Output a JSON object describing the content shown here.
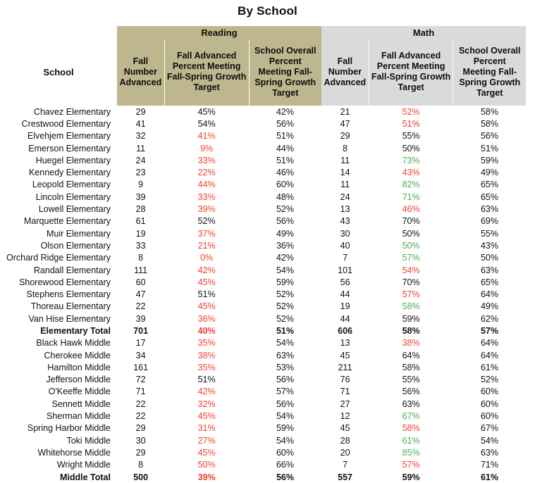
{
  "title": "By School",
  "colors": {
    "reading_header_bg": "#BDB68F",
    "math_header_bg": "#DADADA",
    "below_target": "#F0402F",
    "above_target": "#4CB050",
    "neutral": "#111111"
  },
  "header": {
    "school_label": "School",
    "groups": [
      {
        "label": "Reading",
        "span": 3,
        "theme": "reading"
      },
      {
        "label": "Math",
        "span": 3,
        "theme": "math"
      }
    ],
    "subheaders": [
      "Fall Number Advanced",
      "Fall Advanced Percent Meeting Fall-Spring Growth Target",
      "School Overall Percent Meeting Fall-Spring Growth Target",
      "Fall Number Advanced",
      "Fall Advanced Percent Meeting Fall-Spring Growth Target",
      "School Overall Percent Meeting Fall-Spring Growth Target"
    ]
  },
  "rows": [
    {
      "school": "Chavez Elementary",
      "total": false,
      "cells": [
        {
          "v": "29",
          "c": "plain"
        },
        {
          "v": "45%",
          "c": "plain"
        },
        {
          "v": "42%",
          "c": "plain"
        },
        {
          "v": "21",
          "c": "plain"
        },
        {
          "v": "52%",
          "c": "red"
        },
        {
          "v": "58%",
          "c": "plain"
        }
      ]
    },
    {
      "school": "Crestwood Elementary",
      "total": false,
      "cells": [
        {
          "v": "41",
          "c": "plain"
        },
        {
          "v": "54%",
          "c": "plain"
        },
        {
          "v": "56%",
          "c": "plain"
        },
        {
          "v": "47",
          "c": "plain"
        },
        {
          "v": "51%",
          "c": "red"
        },
        {
          "v": "58%",
          "c": "plain"
        }
      ]
    },
    {
      "school": "Elvehjem Elementary",
      "total": false,
      "cells": [
        {
          "v": "32",
          "c": "plain"
        },
        {
          "v": "41%",
          "c": "red"
        },
        {
          "v": "51%",
          "c": "plain"
        },
        {
          "v": "29",
          "c": "plain"
        },
        {
          "v": "55%",
          "c": "plain"
        },
        {
          "v": "56%",
          "c": "plain"
        }
      ]
    },
    {
      "school": "Emerson Elementary",
      "total": false,
      "cells": [
        {
          "v": "11",
          "c": "plain"
        },
        {
          "v": "9%",
          "c": "red"
        },
        {
          "v": "44%",
          "c": "plain"
        },
        {
          "v": "8",
          "c": "plain"
        },
        {
          "v": "50%",
          "c": "plain"
        },
        {
          "v": "51%",
          "c": "plain"
        }
      ]
    },
    {
      "school": "Huegel Elementary",
      "total": false,
      "cells": [
        {
          "v": "24",
          "c": "plain"
        },
        {
          "v": "33%",
          "c": "red"
        },
        {
          "v": "51%",
          "c": "plain"
        },
        {
          "v": "11",
          "c": "plain"
        },
        {
          "v": "73%",
          "c": "green"
        },
        {
          "v": "59%",
          "c": "plain"
        }
      ]
    },
    {
      "school": "Kennedy Elementary",
      "total": false,
      "cells": [
        {
          "v": "23",
          "c": "plain"
        },
        {
          "v": "22%",
          "c": "red"
        },
        {
          "v": "46%",
          "c": "plain"
        },
        {
          "v": "14",
          "c": "plain"
        },
        {
          "v": "43%",
          "c": "red"
        },
        {
          "v": "49%",
          "c": "plain"
        }
      ]
    },
    {
      "school": "Leopold Elementary",
      "total": false,
      "cells": [
        {
          "v": "9",
          "c": "plain"
        },
        {
          "v": "44%",
          "c": "red"
        },
        {
          "v": "60%",
          "c": "plain"
        },
        {
          "v": "11",
          "c": "plain"
        },
        {
          "v": "82%",
          "c": "green"
        },
        {
          "v": "65%",
          "c": "plain"
        }
      ]
    },
    {
      "school": "Lincoln Elementary",
      "total": false,
      "cells": [
        {
          "v": "39",
          "c": "plain"
        },
        {
          "v": "33%",
          "c": "red"
        },
        {
          "v": "48%",
          "c": "plain"
        },
        {
          "v": "24",
          "c": "plain"
        },
        {
          "v": "71%",
          "c": "green"
        },
        {
          "v": "65%",
          "c": "plain"
        }
      ]
    },
    {
      "school": "Lowell Elementary",
      "total": false,
      "cells": [
        {
          "v": "28",
          "c": "plain"
        },
        {
          "v": "39%",
          "c": "red"
        },
        {
          "v": "52%",
          "c": "plain"
        },
        {
          "v": "13",
          "c": "plain"
        },
        {
          "v": "46%",
          "c": "red"
        },
        {
          "v": "63%",
          "c": "plain"
        }
      ]
    },
    {
      "school": "Marquette Elementary",
      "total": false,
      "cells": [
        {
          "v": "61",
          "c": "plain"
        },
        {
          "v": "52%",
          "c": "plain"
        },
        {
          "v": "56%",
          "c": "plain"
        },
        {
          "v": "43",
          "c": "plain"
        },
        {
          "v": "70%",
          "c": "plain"
        },
        {
          "v": "69%",
          "c": "plain"
        }
      ]
    },
    {
      "school": "Muir Elementary",
      "total": false,
      "cells": [
        {
          "v": "19",
          "c": "plain"
        },
        {
          "v": "37%",
          "c": "red"
        },
        {
          "v": "49%",
          "c": "plain"
        },
        {
          "v": "30",
          "c": "plain"
        },
        {
          "v": "50%",
          "c": "plain"
        },
        {
          "v": "55%",
          "c": "plain"
        }
      ]
    },
    {
      "school": "Olson Elementary",
      "total": false,
      "cells": [
        {
          "v": "33",
          "c": "plain"
        },
        {
          "v": "21%",
          "c": "red"
        },
        {
          "v": "36%",
          "c": "plain"
        },
        {
          "v": "40",
          "c": "plain"
        },
        {
          "v": "50%",
          "c": "green"
        },
        {
          "v": "43%",
          "c": "plain"
        }
      ]
    },
    {
      "school": "Orchard Ridge Elementary",
      "total": false,
      "cells": [
        {
          "v": "8",
          "c": "plain"
        },
        {
          "v": "0%",
          "c": "red"
        },
        {
          "v": "42%",
          "c": "plain"
        },
        {
          "v": "7",
          "c": "plain"
        },
        {
          "v": "57%",
          "c": "green"
        },
        {
          "v": "50%",
          "c": "plain"
        }
      ]
    },
    {
      "school": "Randall Elementary",
      "total": false,
      "cells": [
        {
          "v": "111",
          "c": "plain"
        },
        {
          "v": "42%",
          "c": "red"
        },
        {
          "v": "54%",
          "c": "plain"
        },
        {
          "v": "101",
          "c": "plain"
        },
        {
          "v": "54%",
          "c": "red"
        },
        {
          "v": "63%",
          "c": "plain"
        }
      ]
    },
    {
      "school": "Shorewood Elementary",
      "total": false,
      "cells": [
        {
          "v": "60",
          "c": "plain"
        },
        {
          "v": "45%",
          "c": "red"
        },
        {
          "v": "59%",
          "c": "plain"
        },
        {
          "v": "56",
          "c": "plain"
        },
        {
          "v": "70%",
          "c": "plain"
        },
        {
          "v": "65%",
          "c": "plain"
        }
      ]
    },
    {
      "school": "Stephens Elementary",
      "total": false,
      "cells": [
        {
          "v": "47",
          "c": "plain"
        },
        {
          "v": "51%",
          "c": "plain"
        },
        {
          "v": "52%",
          "c": "plain"
        },
        {
          "v": "44",
          "c": "plain"
        },
        {
          "v": "57%",
          "c": "red"
        },
        {
          "v": "64%",
          "c": "plain"
        }
      ]
    },
    {
      "school": "Thoreau Elementary",
      "total": false,
      "cells": [
        {
          "v": "22",
          "c": "plain"
        },
        {
          "v": "45%",
          "c": "red"
        },
        {
          "v": "52%",
          "c": "plain"
        },
        {
          "v": "19",
          "c": "plain"
        },
        {
          "v": "58%",
          "c": "green"
        },
        {
          "v": "49%",
          "c": "plain"
        }
      ]
    },
    {
      "school": "Van Hise Elementary",
      "total": false,
      "cells": [
        {
          "v": "39",
          "c": "plain"
        },
        {
          "v": "36%",
          "c": "red"
        },
        {
          "v": "52%",
          "c": "plain"
        },
        {
          "v": "44",
          "c": "plain"
        },
        {
          "v": "59%",
          "c": "plain"
        },
        {
          "v": "62%",
          "c": "plain"
        }
      ]
    },
    {
      "school": "Elementary Total",
      "total": true,
      "cells": [
        {
          "v": "701",
          "c": "plain"
        },
        {
          "v": "40%",
          "c": "red"
        },
        {
          "v": "51%",
          "c": "plain"
        },
        {
          "v": "606",
          "c": "plain"
        },
        {
          "v": "58%",
          "c": "plain"
        },
        {
          "v": "57%",
          "c": "plain"
        }
      ]
    },
    {
      "school": "Black Hawk Middle",
      "total": false,
      "cells": [
        {
          "v": "17",
          "c": "plain"
        },
        {
          "v": "35%",
          "c": "red"
        },
        {
          "v": "54%",
          "c": "plain"
        },
        {
          "v": "13",
          "c": "plain"
        },
        {
          "v": "38%",
          "c": "red"
        },
        {
          "v": "64%",
          "c": "plain"
        }
      ]
    },
    {
      "school": "Cherokee Middle",
      "total": false,
      "cells": [
        {
          "v": "34",
          "c": "plain"
        },
        {
          "v": "38%",
          "c": "red"
        },
        {
          "v": "63%",
          "c": "plain"
        },
        {
          "v": "45",
          "c": "plain"
        },
        {
          "v": "64%",
          "c": "plain"
        },
        {
          "v": "64%",
          "c": "plain"
        }
      ]
    },
    {
      "school": "Hamilton Middle",
      "total": false,
      "cells": [
        {
          "v": "161",
          "c": "plain"
        },
        {
          "v": "35%",
          "c": "red"
        },
        {
          "v": "53%",
          "c": "plain"
        },
        {
          "v": "211",
          "c": "plain"
        },
        {
          "v": "58%",
          "c": "plain"
        },
        {
          "v": "61%",
          "c": "plain"
        }
      ]
    },
    {
      "school": "Jefferson Middle",
      "total": false,
      "cells": [
        {
          "v": "72",
          "c": "plain"
        },
        {
          "v": "51%",
          "c": "plain"
        },
        {
          "v": "56%",
          "c": "plain"
        },
        {
          "v": "76",
          "c": "plain"
        },
        {
          "v": "55%",
          "c": "plain"
        },
        {
          "v": "52%",
          "c": "plain"
        }
      ]
    },
    {
      "school": "O'Keeffe Middle",
      "total": false,
      "cells": [
        {
          "v": "71",
          "c": "plain"
        },
        {
          "v": "42%",
          "c": "red"
        },
        {
          "v": "57%",
          "c": "plain"
        },
        {
          "v": "71",
          "c": "plain"
        },
        {
          "v": "56%",
          "c": "plain"
        },
        {
          "v": "60%",
          "c": "plain"
        }
      ]
    },
    {
      "school": "Sennett Middle",
      "total": false,
      "cells": [
        {
          "v": "22",
          "c": "plain"
        },
        {
          "v": "32%",
          "c": "red"
        },
        {
          "v": "56%",
          "c": "plain"
        },
        {
          "v": "27",
          "c": "plain"
        },
        {
          "v": "63%",
          "c": "plain"
        },
        {
          "v": "60%",
          "c": "plain"
        }
      ]
    },
    {
      "school": "Sherman Middle",
      "total": false,
      "cells": [
        {
          "v": "22",
          "c": "plain"
        },
        {
          "v": "45%",
          "c": "red"
        },
        {
          "v": "54%",
          "c": "plain"
        },
        {
          "v": "12",
          "c": "plain"
        },
        {
          "v": "67%",
          "c": "green"
        },
        {
          "v": "60%",
          "c": "plain"
        }
      ]
    },
    {
      "school": "Spring Harbor Middle",
      "total": false,
      "cells": [
        {
          "v": "29",
          "c": "plain"
        },
        {
          "v": "31%",
          "c": "red"
        },
        {
          "v": "59%",
          "c": "plain"
        },
        {
          "v": "45",
          "c": "plain"
        },
        {
          "v": "58%",
          "c": "red"
        },
        {
          "v": "67%",
          "c": "plain"
        }
      ]
    },
    {
      "school": "Toki Middle",
      "total": false,
      "cells": [
        {
          "v": "30",
          "c": "plain"
        },
        {
          "v": "27%",
          "c": "red"
        },
        {
          "v": "54%",
          "c": "plain"
        },
        {
          "v": "28",
          "c": "plain"
        },
        {
          "v": "61%",
          "c": "green"
        },
        {
          "v": "54%",
          "c": "plain"
        }
      ]
    },
    {
      "school": "Whitehorse Middle",
      "total": false,
      "cells": [
        {
          "v": "29",
          "c": "plain"
        },
        {
          "v": "45%",
          "c": "red"
        },
        {
          "v": "60%",
          "c": "plain"
        },
        {
          "v": "20",
          "c": "plain"
        },
        {
          "v": "85%",
          "c": "green"
        },
        {
          "v": "63%",
          "c": "plain"
        }
      ]
    },
    {
      "school": "Wright Middle",
      "total": false,
      "cells": [
        {
          "v": "8",
          "c": "plain"
        },
        {
          "v": "50%",
          "c": "red"
        },
        {
          "v": "66%",
          "c": "plain"
        },
        {
          "v": "7",
          "c": "plain"
        },
        {
          "v": "57%",
          "c": "red"
        },
        {
          "v": "71%",
          "c": "plain"
        }
      ]
    },
    {
      "school": "Middle Total",
      "total": true,
      "cells": [
        {
          "v": "500",
          "c": "plain"
        },
        {
          "v": "39%",
          "c": "red"
        },
        {
          "v": "56%",
          "c": "plain"
        },
        {
          "v": "557",
          "c": "plain"
        },
        {
          "v": "59%",
          "c": "plain"
        },
        {
          "v": "61%",
          "c": "plain"
        }
      ]
    }
  ]
}
